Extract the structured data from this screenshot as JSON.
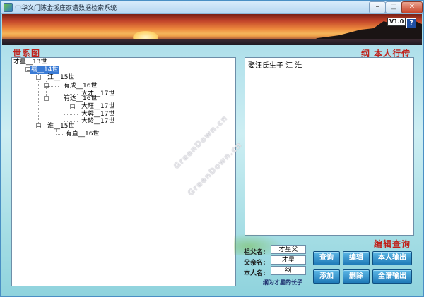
{
  "window": {
    "title": "中华义门陈金溪庄家谱数据检索系统",
    "minimize_label": "–",
    "maximize_label": "□",
    "close_label": "✕"
  },
  "banner": {
    "version": "V1.0",
    "help_label": "?"
  },
  "tree_panel": {
    "label": "世系图",
    "nodes": [
      {
        "text": "才星__13世",
        "toggle": ""
      },
      {
        "text": "纲__14世",
        "toggle": "−",
        "selected": true
      },
      {
        "text": "江__15世",
        "toggle": "−"
      },
      {
        "text": "有成__16世",
        "toggle": "−"
      },
      {
        "text": "大才__17世",
        "toggle": ""
      },
      {
        "text": "有达__16世",
        "toggle": "−"
      },
      {
        "text": "大旺__17世",
        "toggle": "+"
      },
      {
        "text": "大蓉__17世",
        "toggle": ""
      },
      {
        "text": "大珍__17世",
        "toggle": ""
      },
      {
        "text": "淮__15世",
        "toggle": "−"
      },
      {
        "text": "有直__16世",
        "toggle": ""
      }
    ]
  },
  "bio_panel": {
    "label": "纲 本人行传",
    "content": "娶汪氏生子 江 淮"
  },
  "query": {
    "title": "编辑查询",
    "grandfather_label": "祖父名:",
    "grandfather_value": "才星父",
    "father_label": "父亲名:",
    "father_value": "才星",
    "self_label": "本人名:",
    "self_value": "纲",
    "relation_note": "纲为才星的长子",
    "buttons": {
      "query": "查询",
      "edit": "编辑",
      "output_self": "本人输出",
      "add": "添加",
      "delete": "删除",
      "output_all": "全谱输出"
    }
  },
  "watermark": {
    "text": "GreenDown.cn"
  }
}
